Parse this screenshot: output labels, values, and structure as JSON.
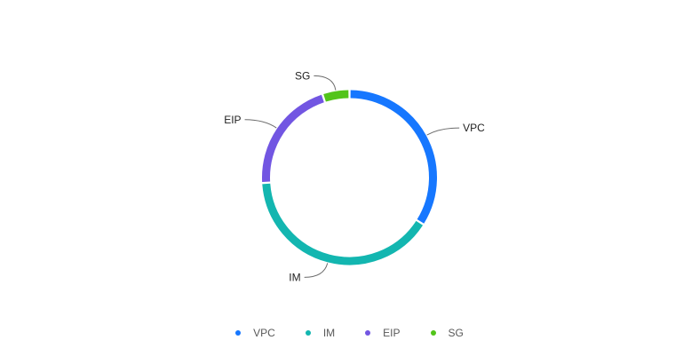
{
  "chart_data": {
    "type": "pie",
    "variant": "donut",
    "categories": [
      "VPC",
      "IM",
      "EIP",
      "SG"
    ],
    "values": [
      34,
      40,
      21,
      5
    ],
    "colors": {
      "VPC": "#1677ff",
      "IM": "#13b6b0",
      "EIP": "#7256e2",
      "SG": "#52c41a"
    },
    "legend_position": "bottom-center",
    "title": ""
  },
  "legend": {
    "items": [
      {
        "label": "VPC",
        "color": "#1677ff"
      },
      {
        "label": "IM",
        "color": "#13b6b0"
      },
      {
        "label": "EIP",
        "color": "#7256e2"
      },
      {
        "label": "SG",
        "color": "#52c41a"
      }
    ]
  }
}
